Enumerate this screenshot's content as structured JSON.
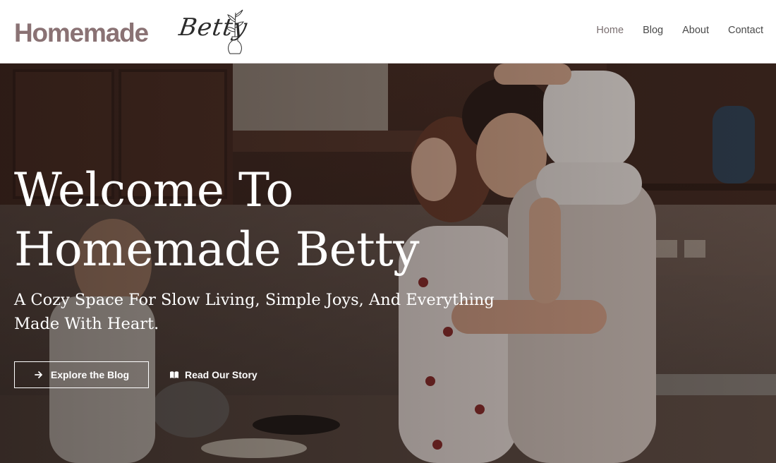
{
  "brand": {
    "wordmark": "Homemade",
    "script": "Betty",
    "logo_icon": "vase-plant-icon",
    "color": "#8a7274"
  },
  "nav": {
    "items": [
      {
        "label": "Home",
        "active": true
      },
      {
        "label": "Blog",
        "active": false
      },
      {
        "label": "About",
        "active": false
      },
      {
        "label": "Contact",
        "active": false
      }
    ]
  },
  "hero": {
    "title_line1": "Welcome To",
    "title_line2": "Homemade Betty",
    "subtitle_line1": "A Cozy Space For Slow Living, Simple Joys, And Everything",
    "subtitle_line2": "Made With Heart.",
    "background_image": "family-in-kitchen-photo",
    "primary_button": {
      "label": "Explore the Blog",
      "icon": "arrow-right-icon"
    },
    "secondary_button": {
      "label": "Read Our Story",
      "icon": "open-book-icon"
    }
  }
}
